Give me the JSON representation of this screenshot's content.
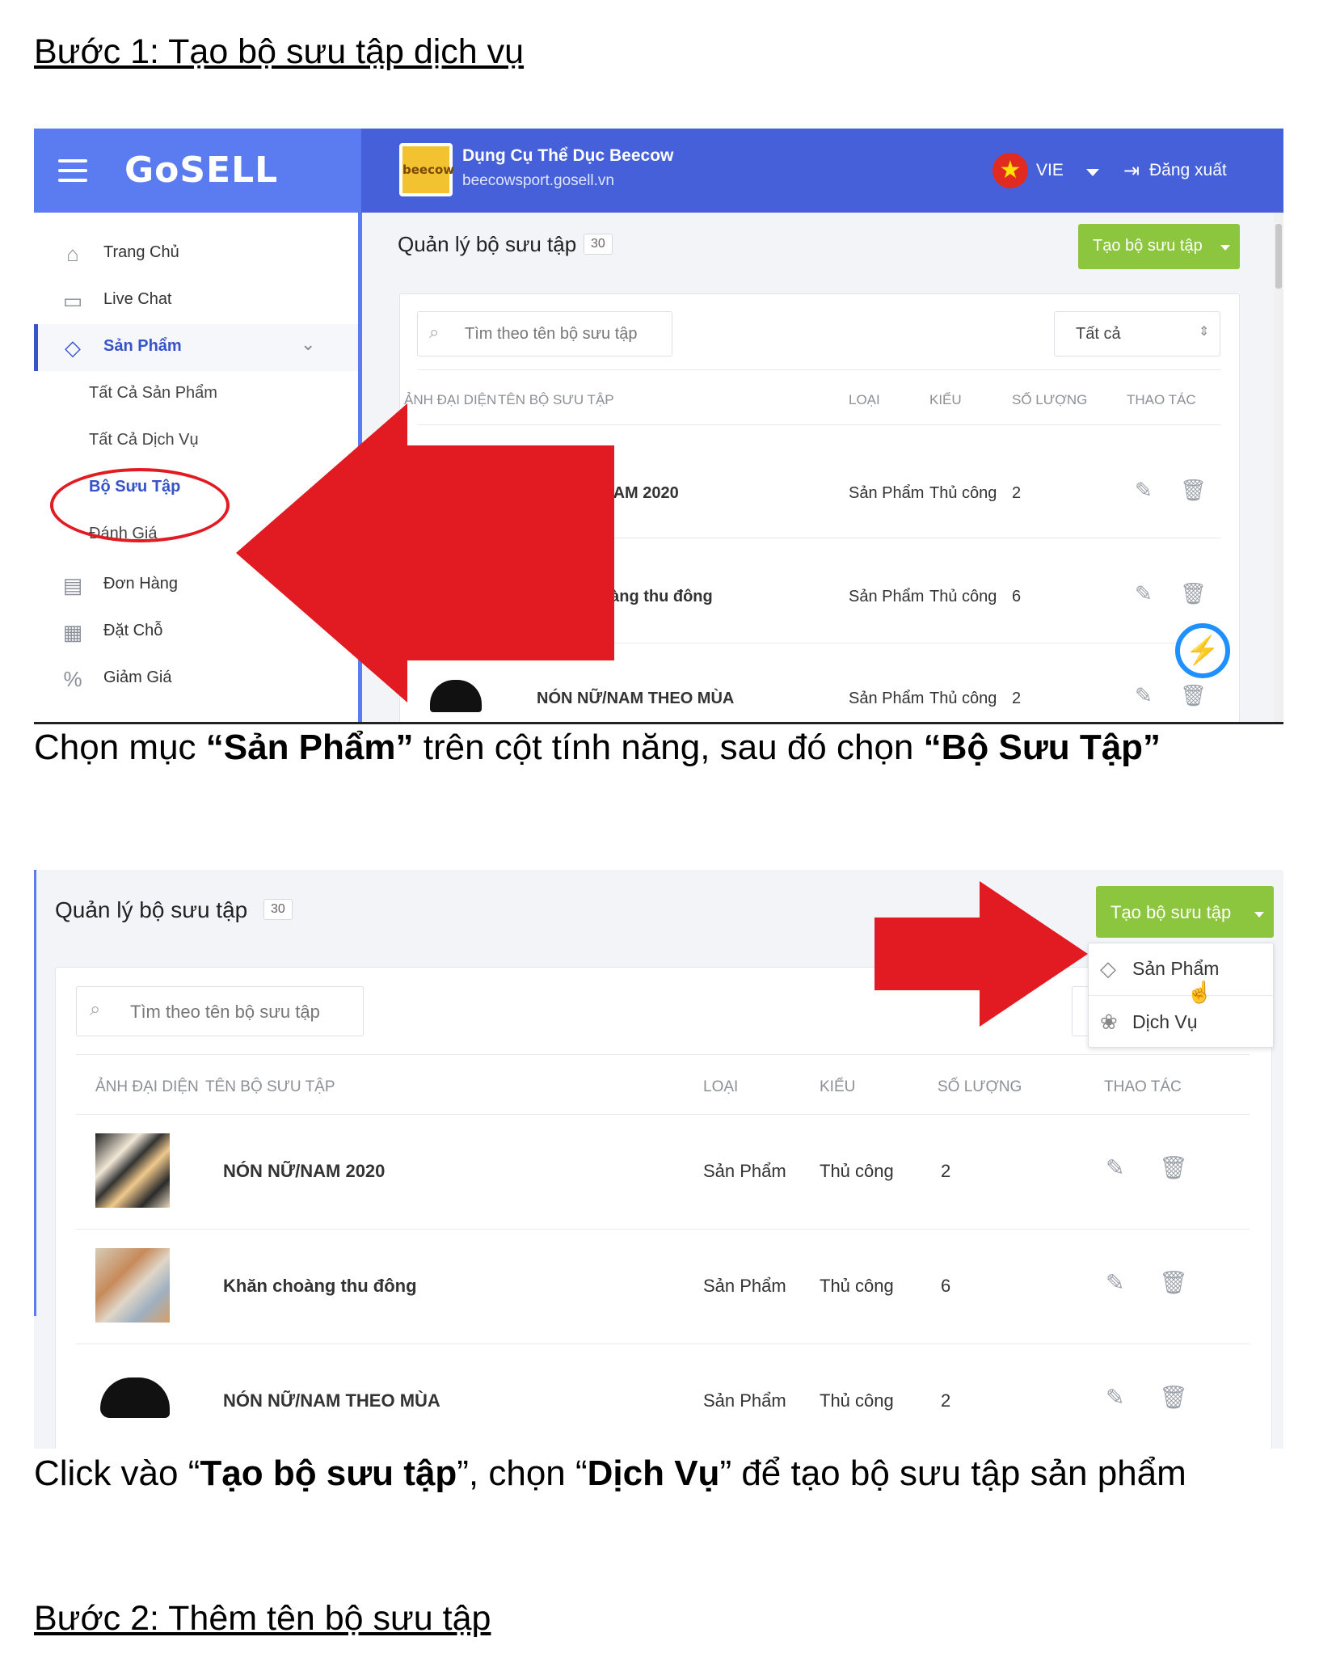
{
  "step1": {
    "heading": "Bước 1: Tạo bộ sưu tập dịch vụ",
    "caption_parts": [
      "Chọn mục ",
      "“Sản Phẩm”",
      " trên cột tính năng, sau đó chọn ",
      "“Bộ Sưu Tập”"
    ]
  },
  "step1_screenshot": {
    "logo": "GoSELL",
    "store": {
      "logo_text": "beecow",
      "name": "Dụng Cụ Thể Dục Beecow",
      "url": "beecowsport.gosell.vn"
    },
    "language": "VIE",
    "logout": "Đăng xuất",
    "sidebar": {
      "items": [
        {
          "label": "Trang Chủ",
          "icon": "home-icon"
        },
        {
          "label": "Live Chat",
          "icon": "chat-icon"
        },
        {
          "label": "Sản Phẩm",
          "icon": "tag-icon"
        },
        {
          "label": "Đơn Hàng",
          "icon": "document-icon"
        },
        {
          "label": "Đặt Chỗ",
          "icon": "calendar-icon"
        },
        {
          "label": "Giảm Giá",
          "icon": "discount-icon"
        }
      ],
      "sub_items": [
        "Tất Cả Sản Phẩm",
        "Tất Cả Dịch Vụ",
        "Bộ Sưu Tập",
        "Đánh Giá"
      ]
    },
    "page_title": "Quản lý bộ sưu tập",
    "count": "30",
    "create_button": "Tạo bộ sưu tập",
    "search_placeholder": "Tìm theo tên bộ sưu tập",
    "filter": "Tất cả",
    "columns": [
      "ẢNH ĐẠI DIỆN",
      "TÊN BỘ SƯU TẬP",
      "LOẠI",
      "KIỂU",
      "SỐ LƯỢNG",
      "THAO TÁC"
    ],
    "rows": [
      {
        "name": "Ữ/NAM 2020",
        "type": "Sản Phẩm",
        "kind": "Thủ công",
        "qty": "2"
      },
      {
        "name": "Khăn choàng thu đông",
        "type": "Sản Phẩm",
        "kind": "Thủ công",
        "qty": "6"
      },
      {
        "name": "NÓN NỮ/NAM THEO MÙA",
        "type": "Sản Phẩm",
        "kind": "Thủ công",
        "qty": "2"
      }
    ]
  },
  "step1b": {
    "caption_parts": [
      "Click vào “",
      "Tạo bộ sưu tập",
      "”, chọn “",
      "Dịch Vụ",
      "” để tạo bộ sưu tập sản phẩm"
    ]
  },
  "step2_screenshot": {
    "page_title": "Quản lý bộ sưu tập",
    "count": "30",
    "create_button": "Tạo bộ sưu tập",
    "dropdown": [
      {
        "label": "Sản Phẩm",
        "icon": "tag-icon"
      },
      {
        "label": "Dịch Vụ",
        "icon": "flower-icon"
      }
    ],
    "search_placeholder": "Tìm theo tên bộ sưu tập",
    "columns": [
      "ẢNH ĐẠI DIỆN",
      "TÊN BỘ SƯU TẬP",
      "LOẠI",
      "KIỂU",
      "SỐ LƯỢNG",
      "THAO TÁC"
    ],
    "rows": [
      {
        "name": "NÓN NỮ/NAM 2020",
        "type": "Sản Phẩm",
        "kind": "Thủ công",
        "qty": "2"
      },
      {
        "name": "Khăn choàng thu đông",
        "type": "Sản Phẩm",
        "kind": "Thủ công",
        "qty": "6"
      },
      {
        "name": "NÓN NỮ/NAM THEO MÙA",
        "type": "Sản Phẩm",
        "kind": "Thủ công",
        "qty": "2"
      }
    ]
  },
  "step2": {
    "heading": "Bước 2: Thêm tên bộ sưu tập"
  },
  "colors": {
    "topbar": "#4560d8",
    "sidebar_accent": "#3653c9",
    "button_green": "#8cc63f",
    "annotation_red": "#e21a22",
    "messenger_blue": "#1e90ff"
  }
}
